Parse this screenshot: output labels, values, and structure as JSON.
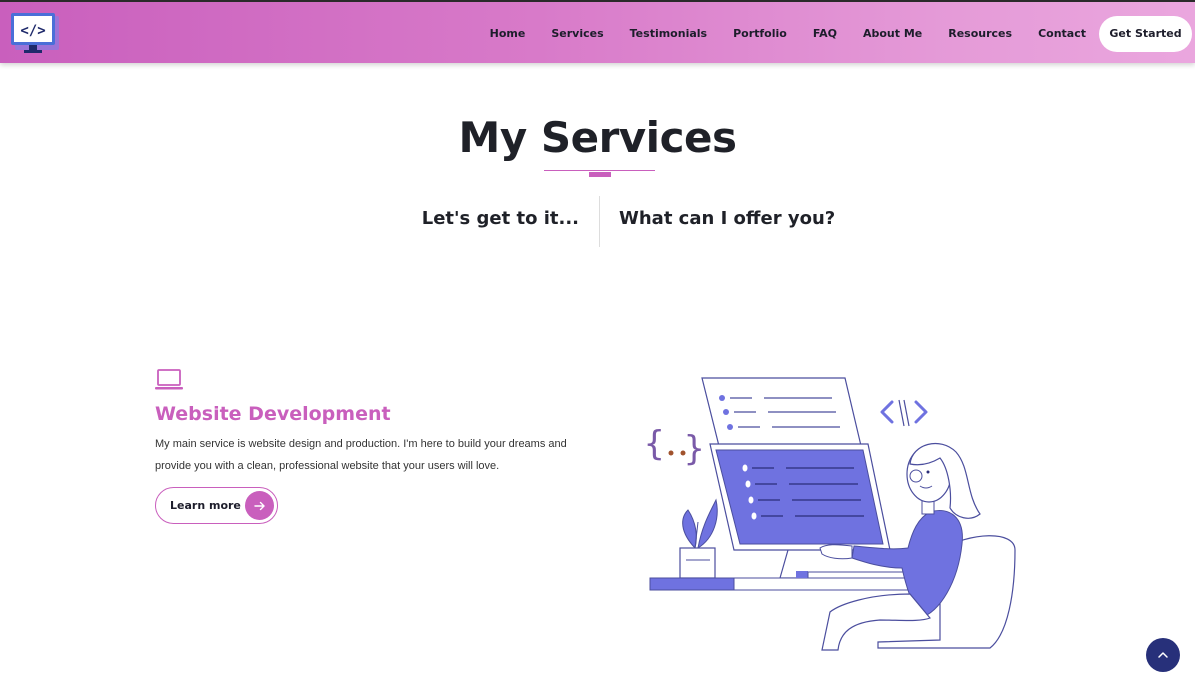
{
  "header": {
    "logo_icon": "code-monitor-icon",
    "nav": [
      "Home",
      "Services",
      "Testimonials",
      "Portfolio",
      "FAQ",
      "About Me",
      "Resources",
      "Contact"
    ],
    "cta_label": "Get Started"
  },
  "services": {
    "title": "My Services",
    "tagline_left": "Let's get to it...",
    "tagline_right": "What can I offer you?"
  },
  "service_card": {
    "icon": "laptop-icon",
    "title": "Website Development",
    "description": "My main service is website design and production. I'm here to build your dreams and provide you with a clean, professional website that your users will love.",
    "button_label": "Learn more",
    "button_icon": "arrow-right-icon"
  },
  "scroll_top_icon": "chevron-up-icon",
  "colors": {
    "accent": "#c95fbd",
    "illustration_purple": "#6f72e0",
    "dark_navy": "#27307a",
    "text": "#1f2128"
  }
}
